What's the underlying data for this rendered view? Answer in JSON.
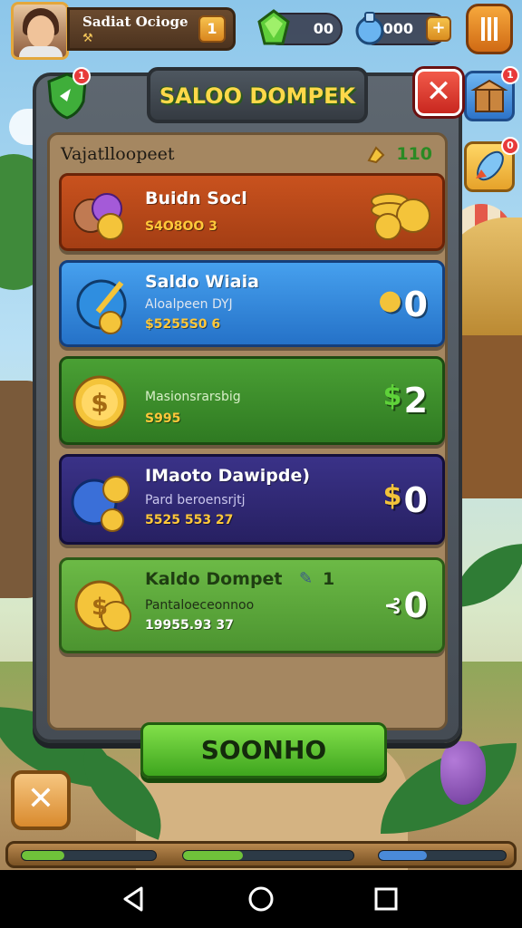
{
  "hud": {
    "player_name": "Sadiat Ocioge",
    "level": "1",
    "currency_1_value": "00",
    "currency_2_value": "000",
    "plus_label": "+"
  },
  "side_buttons": {
    "shop_badge": "1",
    "offer_badge": "0"
  },
  "panel": {
    "title": "SALOO DOMPEK",
    "close_label": "✕",
    "shield_badge": "1",
    "subheader_label": "Vajatlloopeet",
    "subheader_value": "110",
    "rows": [
      {
        "title": "Buidn Socl",
        "subtitle": "",
        "number": "S4O8OO 3",
        "value": ""
      },
      {
        "title": "Saldo Wiaia",
        "subtitle": "Aloalpeen DYJ",
        "number": "$5255S0 6",
        "value": "0"
      },
      {
        "title": "",
        "subtitle": "Masionsrarsbig",
        "number": "S995",
        "value": "2"
      },
      {
        "title": "IMaoto Dawipde)",
        "subtitle": "Pard beroensrjtj",
        "number": "5525 553 27",
        "value": "0"
      },
      {
        "title": "Kaldo Dompet",
        "subtitle": "Pantaloeceonnoo",
        "number": "19955.93 37",
        "value": "0",
        "title_badge": "1"
      }
    ],
    "primary_button": "SOONHO"
  },
  "bottom": {
    "close_label": "✕",
    "progress": [
      0.32,
      0.35,
      0.38
    ]
  },
  "colors": {
    "row_orange": "#b9491c",
    "row_blue": "#2f84d6",
    "row_green": "#3f8f2c",
    "row_purple": "#2e2770",
    "row_lightgreen": "#5ea63c",
    "title_yellow": "#ffd84a"
  },
  "icons": [
    "shield-icon",
    "gem-icon",
    "potion-icon",
    "crate-icon",
    "rocket-icon",
    "coin-icon",
    "back-icon",
    "home-icon",
    "recents-icon"
  ]
}
